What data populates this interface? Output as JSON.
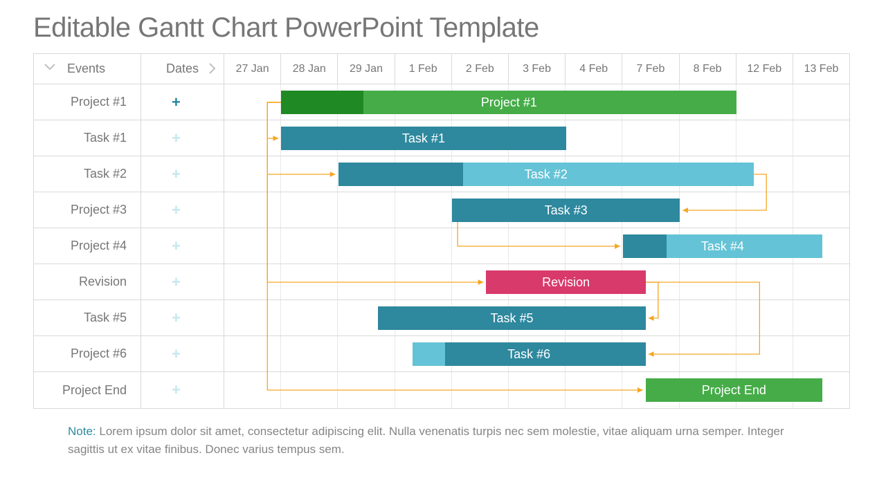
{
  "title": "Editable Gantt Chart PowerPoint Template",
  "header": {
    "events_label": "Events",
    "dates_label": "Dates"
  },
  "dates": [
    "27 Jan",
    "28 Jan",
    "29 Jan",
    "1 Feb",
    "2 Feb",
    "3 Feb",
    "4 Feb",
    "7 Feb",
    "8 Feb",
    "12 Feb",
    "13 Feb"
  ],
  "rows": [
    {
      "event": "Project #1",
      "plus_color": "#2285a2"
    },
    {
      "event": "Task #1",
      "plus_color": "#c6e7ed"
    },
    {
      "event": "Task #2",
      "plus_color": "#c6e7ed"
    },
    {
      "event": "Project #3",
      "plus_color": "#c6e7ed"
    },
    {
      "event": "Project #4",
      "plus_color": "#c6e7ed"
    },
    {
      "event": "Revision",
      "plus_color": "#c6e7ed"
    },
    {
      "event": "Task #5",
      "plus_color": "#c6e7ed"
    },
    {
      "event": "Project #6",
      "plus_color": "#c6e7ed"
    },
    {
      "event": "Project End",
      "plus_color": "#c6e7ed"
    }
  ],
  "bars": [
    {
      "row": 0,
      "start": 1.0,
      "end": 9.0,
      "base_color": "#45ac48",
      "progress": 0.18,
      "prog_color": "#1f8a24",
      "label": "Project #1"
    },
    {
      "row": 1,
      "start": 1.0,
      "end": 6.0,
      "base_color": "#2e889e",
      "progress": 0,
      "prog_color": "#206f83",
      "label": "Task #1"
    },
    {
      "row": 2,
      "start": 2.0,
      "end": 9.3,
      "base_color": "#64c3d6",
      "progress": 0.3,
      "prog_color": "#2e889e",
      "label": "Task #2"
    },
    {
      "row": 3,
      "start": 4.0,
      "end": 8.0,
      "base_color": "#2e889e",
      "progress": 0,
      "prog_color": "#206f83",
      "label": "Task #3"
    },
    {
      "row": 4,
      "start": 7.0,
      "end": 10.5,
      "base_color": "#64c3d6",
      "progress": 0.22,
      "prog_color": "#2e889e",
      "label": "Task #4"
    },
    {
      "row": 5,
      "start": 4.6,
      "end": 7.4,
      "base_color": "#d83a6b",
      "progress": 0,
      "prog_color": "#b02653",
      "label": "Revision"
    },
    {
      "row": 6,
      "start": 2.7,
      "end": 7.4,
      "base_color": "#2e889e",
      "progress": 0,
      "prog_color": "#206f83",
      "label": "Task #5"
    },
    {
      "row": 7,
      "start": 3.3,
      "end": 7.4,
      "base_color": "#2e889e",
      "progress": 0.14,
      "prog_from": "right",
      "prog_color": "#64c3d6",
      "label": "Task #6"
    },
    {
      "row": 8,
      "start": 7.4,
      "end": 10.5,
      "base_color": "#45ac48",
      "progress": 0,
      "prog_color": "#1f8a24",
      "label": "Project End"
    }
  ],
  "connectors": [
    {
      "from_bar": 0,
      "to_bar": 1
    },
    {
      "from_bar": 0,
      "to_bar": 2
    },
    {
      "from_bar": 2,
      "to_bar": 3,
      "from": "end"
    },
    {
      "from_bar": 3,
      "to_bar": 4,
      "from": "start-down"
    },
    {
      "from_bar": 0,
      "to_bar": 5
    },
    {
      "from_bar": 5,
      "to_bar": 6,
      "from": "end"
    },
    {
      "from_bar": 5,
      "to_bar": 7,
      "from": "end",
      "via": 9.4
    },
    {
      "from_bar": 0,
      "to_bar": 8
    }
  ],
  "connector_color": "#f5a623",
  "note": {
    "label": "Note: ",
    "text": "Lorem ipsum dolor sit amet, consectetur adipiscing elit. Nulla venenatis turpis nec sem molestie, vitae aliquam urna semper. Integer sagittis ut ex vitae finibus. Donec varius tempus sem."
  },
  "chart_data": {
    "type": "bar",
    "title": "Editable Gantt Chart PowerPoint Template",
    "xlabel": "Dates",
    "ylabel": "Events",
    "categories": [
      "27 Jan",
      "28 Jan",
      "29 Jan",
      "1 Feb",
      "2 Feb",
      "3 Feb",
      "4 Feb",
      "7 Feb",
      "8 Feb",
      "12 Feb",
      "13 Feb"
    ],
    "series": [
      {
        "name": "Project #1",
        "start": "28 Jan",
        "end": "8 Feb",
        "progress_pct": 18,
        "color": "#45ac48"
      },
      {
        "name": "Task #1",
        "start": "28 Jan",
        "end": "3 Feb",
        "progress_pct": 0,
        "color": "#2e889e"
      },
      {
        "name": "Task #2",
        "start": "29 Jan",
        "end": "8 Feb",
        "progress_pct": 30,
        "color": "#64c3d6"
      },
      {
        "name": "Task #3",
        "start": "2 Feb",
        "end": "7 Feb",
        "progress_pct": 0,
        "color": "#2e889e"
      },
      {
        "name": "Task #4",
        "start": "7 Feb",
        "end": "13 Feb",
        "progress_pct": 22,
        "color": "#64c3d6"
      },
      {
        "name": "Revision",
        "start": "2 Feb",
        "end": "4 Feb",
        "progress_pct": 0,
        "color": "#d83a6b"
      },
      {
        "name": "Task #5",
        "start": "29 Jan",
        "end": "4 Feb",
        "progress_pct": 0,
        "color": "#2e889e"
      },
      {
        "name": "Task #6",
        "start": "1 Feb",
        "end": "4 Feb",
        "progress_pct": 14,
        "color": "#2e889e"
      },
      {
        "name": "Project End",
        "start": "4 Feb",
        "end": "13 Feb",
        "progress_pct": 0,
        "color": "#45ac48"
      }
    ],
    "dependencies": [
      [
        "Project #1",
        "Task #1"
      ],
      [
        "Project #1",
        "Task #2"
      ],
      [
        "Task #2",
        "Task #3"
      ],
      [
        "Task #3",
        "Task #4"
      ],
      [
        "Project #1",
        "Revision"
      ],
      [
        "Revision",
        "Task #5"
      ],
      [
        "Revision",
        "Task #6"
      ],
      [
        "Project #1",
        "Project End"
      ]
    ]
  }
}
